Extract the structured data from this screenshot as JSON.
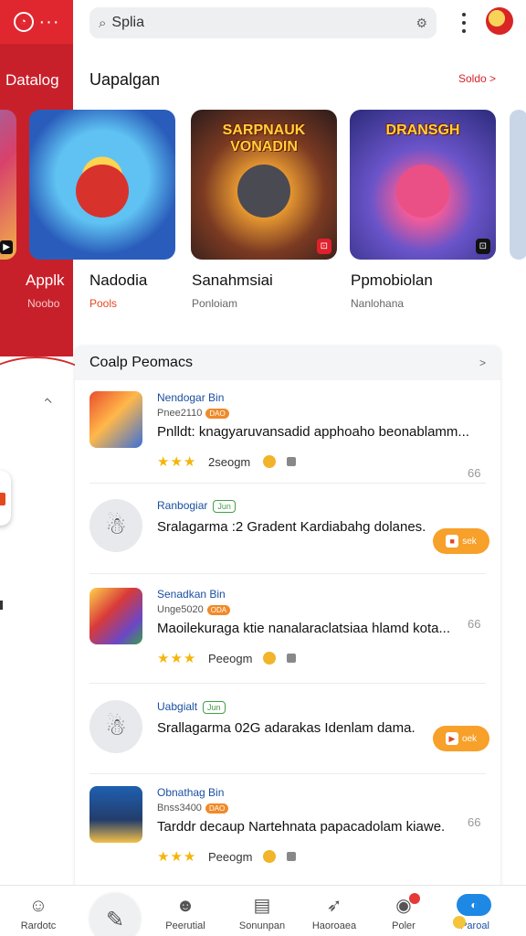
{
  "drawer": {
    "title": "Datalog",
    "name": "Applk",
    "sub": "Noobo"
  },
  "search": {
    "value": "Splia"
  },
  "section": {
    "title": "Uapalgan",
    "more": "Soldo >"
  },
  "cards": [
    {
      "headline": "",
      "name": "Nadodia",
      "sub": "Pools"
    },
    {
      "headline": "SARPNAUK VONADIN",
      "name": "Sanahmsiai",
      "sub": "Ponloiam"
    },
    {
      "headline": "DRANSGH",
      "name": "Ppmobiolan",
      "sub": "Nanlohana"
    }
  ],
  "panel": {
    "title": "Coalp Peomacs",
    "caret": ">"
  },
  "comments": [
    {
      "name": "Nendogar Bin",
      "meta": "Pnee2110",
      "meta_pill": "DAO",
      "text": "Pnlldt: knagyaruvansadid apphoaho beonablamm...",
      "stars": "★★★",
      "rating": "2seogm",
      "side": "66"
    },
    {
      "name": "Ranbogiar",
      "tag": "Jun",
      "text": "Sralagarma :2 Gradent Kardiabahg dolanes.",
      "action": "sek"
    },
    {
      "name": "Senadkan Bin",
      "meta": "Unge5020",
      "meta_pill": "ODA",
      "text": "Maoilekuraga ktie nanalaraclatsiaa hlamd kota...",
      "stars": "★★★",
      "rating": "Peeogm",
      "side": "66"
    },
    {
      "name": "Uabgialt",
      "tag": "Jun",
      "text": "Srallagarma 02G adarakas Idenlam dama.",
      "action": "oek"
    },
    {
      "name": "Obnathag Bin",
      "meta": "Bnss3400",
      "meta_pill": "DAO",
      "text": "Tarddr decaup Nartehnata papacadolam kiawe.",
      "stars": "★★★",
      "rating": "Peeogm",
      "side": "66"
    }
  ],
  "nav": [
    {
      "label": "Rardotc",
      "icon": "person-icon"
    },
    {
      "label": "",
      "icon": "compose-icon"
    },
    {
      "label": "Peerutial",
      "icon": "group-icon"
    },
    {
      "label": "Sonunpan",
      "icon": "document-icon"
    },
    {
      "label": "Haoroaea",
      "icon": "megaphone-icon"
    },
    {
      "label": "Poler",
      "icon": "coin-icon"
    },
    {
      "label": "Paroal",
      "icon": "chat-icon"
    }
  ],
  "colors": {
    "brand_red": "#c8202a",
    "link_blue": "#1a4fa0",
    "star": "#f5b50a",
    "action_orange": "#f7a02a",
    "active_blue": "#1e88e5"
  }
}
